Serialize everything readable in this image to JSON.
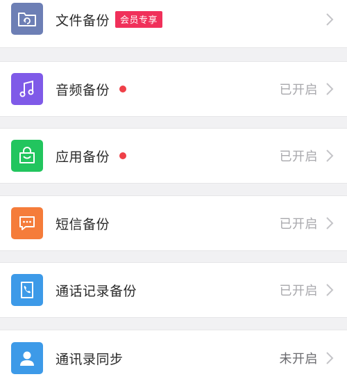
{
  "rows": [
    {
      "label": "文件备份",
      "badge": "会员专享",
      "status": "",
      "icon": "folder-sync-icon",
      "icon_color": "#6d7fb5",
      "has_dot": false
    },
    {
      "label": "音频备份",
      "badge": "",
      "status": "已开启",
      "icon": "music-note-icon",
      "icon_color": "#7f5ae8",
      "has_dot": true
    },
    {
      "label": "应用备份",
      "badge": "",
      "status": "已开启",
      "icon": "app-bag-icon",
      "icon_color": "#22c55e",
      "has_dot": true
    },
    {
      "label": "短信备份",
      "badge": "",
      "status": "已开启",
      "icon": "message-icon",
      "icon_color": "#f57c3a",
      "has_dot": false
    },
    {
      "label": "通话记录备份",
      "badge": "",
      "status": "已开启",
      "icon": "call-log-icon",
      "icon_color": "#3d9ae8",
      "has_dot": false
    },
    {
      "label": "通讯录同步",
      "badge": "",
      "status": "未开启",
      "icon": "contact-person-icon",
      "icon_color": "#3d9ae8",
      "has_dot": false
    }
  ],
  "colors": {
    "dot": "#ef4048",
    "badge_bg": "#f0305a",
    "status_text": "#a8a8ac",
    "chevron": "#c4c4c8"
  }
}
